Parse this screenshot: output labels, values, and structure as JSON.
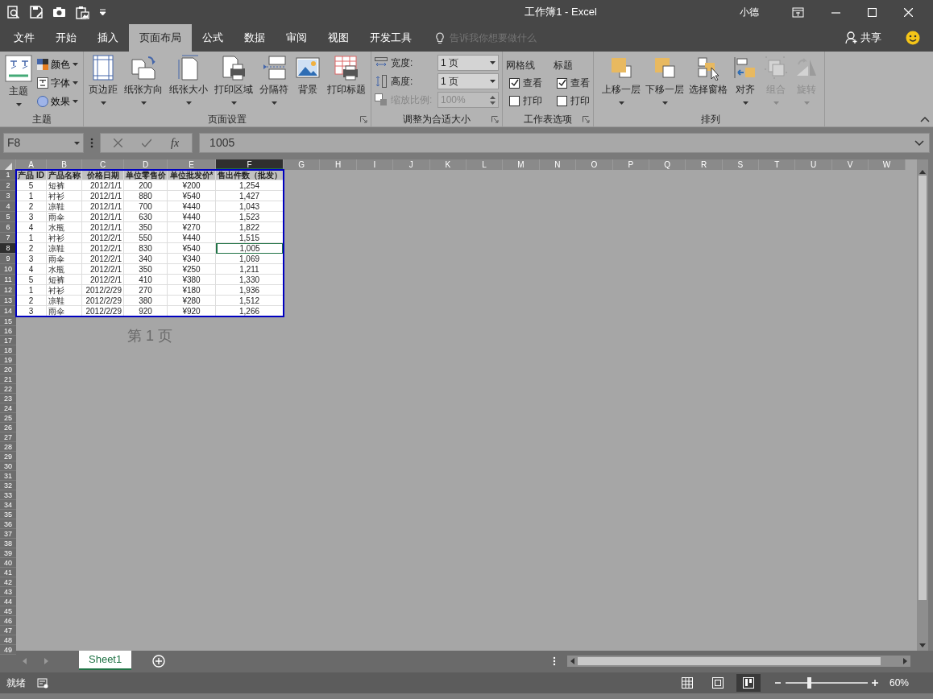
{
  "window": {
    "title": "工作簿1  -  Excel",
    "user": "小德"
  },
  "ribbon_tabs": [
    {
      "label": "文件",
      "selected": false
    },
    {
      "label": "开始",
      "selected": false
    },
    {
      "label": "插入",
      "selected": false
    },
    {
      "label": "页面布局",
      "selected": true
    },
    {
      "label": "公式",
      "selected": false
    },
    {
      "label": "数据",
      "selected": false
    },
    {
      "label": "审阅",
      "selected": false
    },
    {
      "label": "视图",
      "selected": false
    },
    {
      "label": "开发工具",
      "selected": false
    }
  ],
  "tell_me": {
    "placeholder": "告诉我你想要做什么"
  },
  "share": "共享",
  "theme_group": {
    "title": "主题",
    "big_button": "主题",
    "small_buttons": [
      "颜色",
      "字体",
      "效果"
    ]
  },
  "page_setup_group": {
    "title": "页面设置",
    "buttons": [
      "页边距",
      "纸张方向",
      "纸张大小",
      "打印区域",
      "分隔符",
      "背景",
      "打印标题"
    ]
  },
  "scale_group": {
    "title": "调整为合适大小",
    "fields": [
      {
        "label": "宽度:",
        "value": "1 页",
        "disabled": false
      },
      {
        "label": "高度:",
        "value": "1 页",
        "disabled": false
      },
      {
        "label": "缩放比例:",
        "value": "100%",
        "disabled": true
      }
    ]
  },
  "sheet_options_group": {
    "title": "工作表选项",
    "columns": [
      {
        "title": "网格线",
        "options": [
          {
            "label": "查看",
            "checked": true
          },
          {
            "label": "打印",
            "checked": false
          }
        ]
      },
      {
        "title": "标题",
        "options": [
          {
            "label": "查看",
            "checked": true
          },
          {
            "label": "打印",
            "checked": false
          }
        ]
      }
    ]
  },
  "arrange_group": {
    "title": "排列",
    "buttons": [
      {
        "label": "上移一层",
        "disabled": false
      },
      {
        "label": "下移一层",
        "disabled": false
      },
      {
        "label": "选择窗格",
        "disabled": false
      },
      {
        "label": "对齐",
        "disabled": false
      },
      {
        "label": "组合",
        "disabled": true
      },
      {
        "label": "旋转",
        "disabled": true
      }
    ]
  },
  "formula_bar": {
    "name_box": "F8",
    "insert_function": "fx",
    "formula": "1005"
  },
  "sheet": {
    "columns": [
      {
        "label": "A",
        "selected": false
      },
      {
        "label": "B",
        "selected": false
      },
      {
        "label": "C",
        "selected": false
      },
      {
        "label": "D",
        "selected": false
      },
      {
        "label": "E",
        "selected": false
      },
      {
        "label": "F",
        "selected": true
      },
      {
        "label": "G",
        "selected": false
      },
      {
        "label": "H",
        "selected": false
      },
      {
        "label": "I",
        "selected": false
      },
      {
        "label": "J",
        "selected": false
      },
      {
        "label": "K",
        "selected": false
      },
      {
        "label": "L",
        "selected": false
      },
      {
        "label": "M",
        "selected": false
      },
      {
        "label": "N",
        "selected": false
      },
      {
        "label": "O",
        "selected": false
      },
      {
        "label": "P",
        "selected": false
      },
      {
        "label": "Q",
        "selected": false
      },
      {
        "label": "R",
        "selected": false
      },
      {
        "label": "S",
        "selected": false
      },
      {
        "label": "T",
        "selected": false
      },
      {
        "label": "U",
        "selected": false
      },
      {
        "label": "V",
        "selected": false
      },
      {
        "label": "W",
        "selected": false
      }
    ],
    "header_row": [
      "产品 ID",
      "产品名称",
      "价格日期",
      "单位零售价",
      "单位批发价*",
      "售出件数（批发）"
    ],
    "rows": [
      {
        "number": "1",
        "selected": false
      },
      {
        "number": "2",
        "selected": false,
        "cells": [
          "5",
          "短裤",
          "2012/1/1",
          "200",
          "¥200",
          "1,254"
        ]
      },
      {
        "number": "3",
        "selected": false,
        "cells": [
          "1",
          "衬衫",
          "2012/1/1",
          "880",
          "¥540",
          "1,427"
        ]
      },
      {
        "number": "4",
        "selected": false,
        "cells": [
          "2",
          "凉鞋",
          "2012/1/1",
          "700",
          "¥440",
          "1,043"
        ]
      },
      {
        "number": "5",
        "selected": false,
        "cells": [
          "3",
          "雨伞",
          "2012/1/1",
          "630",
          "¥440",
          "1,523"
        ]
      },
      {
        "number": "6",
        "selected": false,
        "cells": [
          "4",
          "水瓶",
          "2012/1/1",
          "350",
          "¥270",
          "1,822"
        ]
      },
      {
        "number": "7",
        "selected": false,
        "cells": [
          "1",
          "衬衫",
          "2012/2/1",
          "550",
          "¥440",
          "1,515"
        ]
      },
      {
        "number": "8",
        "selected": true,
        "cells": [
          "2",
          "凉鞋",
          "2012/2/1",
          "830",
          "¥540",
          "1,005"
        ]
      },
      {
        "number": "9",
        "selected": false,
        "cells": [
          "3",
          "雨伞",
          "2012/2/1",
          "340",
          "¥340",
          "1,069"
        ]
      },
      {
        "number": "10",
        "selected": false,
        "cells": [
          "4",
          "水瓶",
          "2012/2/1",
          "350",
          "¥250",
          "1,211"
        ]
      },
      {
        "number": "11",
        "selected": false,
        "cells": [
          "5",
          "短裤",
          "2012/2/1",
          "410",
          "¥380",
          "1,330"
        ]
      },
      {
        "number": "12",
        "selected": false,
        "cells": [
          "1",
          "衬衫",
          "2012/2/29",
          "270",
          "¥180",
          "1,936"
        ]
      },
      {
        "number": "13",
        "selected": false,
        "cells": [
          "2",
          "凉鞋",
          "2012/2/29",
          "380",
          "¥280",
          "1,512"
        ]
      },
      {
        "number": "14",
        "selected": false,
        "cells": [
          "3",
          "雨伞",
          "2012/2/29",
          "920",
          "¥920",
          "1,266"
        ]
      }
    ],
    "empty_rows": [
      "15",
      "16",
      "17",
      "18",
      "19",
      "20",
      "21",
      "22",
      "23",
      "24",
      "25",
      "26",
      "27",
      "28",
      "29",
      "30",
      "31",
      "32",
      "33",
      "34",
      "35",
      "36",
      "37",
      "38",
      "39",
      "40",
      "41",
      "42",
      "43",
      "44",
      "45",
      "46",
      "47",
      "48",
      "49"
    ],
    "page_label": "第 1 页"
  },
  "sheet_tabs": [
    {
      "label": "Sheet1",
      "selected": true
    }
  ],
  "status_bar": {
    "status": "就绪",
    "views": [
      {
        "kind": "normal",
        "selected": false
      },
      {
        "kind": "page_layout",
        "selected": false
      },
      {
        "kind": "page_break",
        "selected": true
      }
    ],
    "zoom_slider": {
      "level": 0.28
    },
    "zoom": "60%"
  }
}
